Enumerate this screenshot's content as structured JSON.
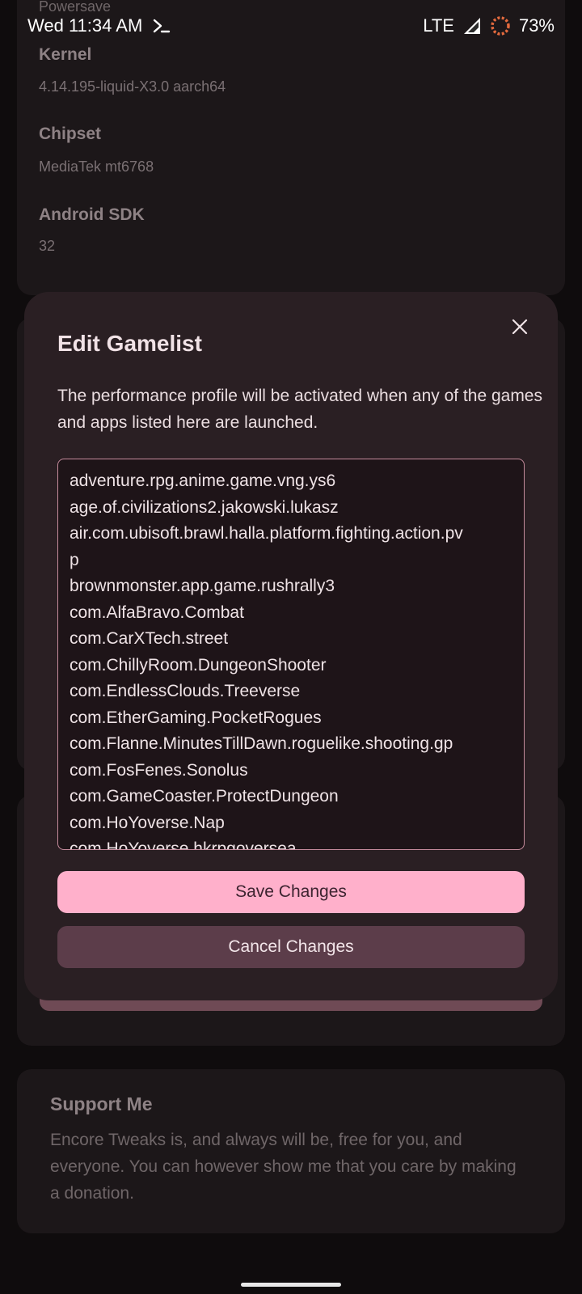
{
  "status_bar": {
    "time": "Wed 11:34 AM",
    "network": "LTE",
    "battery": "73%",
    "battery_ring_color": "#e36a3e"
  },
  "info_card": {
    "profile_value": "Powersave",
    "kernel_label": "Kernel",
    "kernel_value": "4.14.195-liquid-X3.0 aarch64",
    "chipset_label": "Chipset",
    "chipset_value": "MediaTek mt6768",
    "sdk_label": "Android SDK",
    "sdk_value": "32"
  },
  "dialog": {
    "title": "Edit Gamelist",
    "description": "The performance profile will be activated when any of the games and apps listed here are launched.",
    "gamelist": [
      "adventure.rpg.anime.game.vng.ys6",
      "age.of.civilizations2.jakowski.lukasz",
      "air.com.ubisoft.brawl.halla.platform.fighting.action.pv",
      "p",
      "brownmonster.app.game.rushrally3",
      "com.AlfaBravo.Combat",
      "com.CarXTech.street",
      "com.ChillyRoom.DungeonShooter",
      "com.EndlessClouds.Treeverse",
      "com.EtherGaming.PocketRogues",
      "com.Flanne.MinutesTillDawn.roguelike.shooting.gp",
      "com.FosFenes.Sonolus",
      "com.GameCoaster.ProtectDungeon",
      "com.HoYoverse.Nap",
      "com.HoYoverse.hkrpgoversea"
    ],
    "save_label": "Save Changes",
    "cancel_label": "Cancel Changes"
  },
  "support_card": {
    "title": "Support Me",
    "text": "Encore Tweaks is, and always will be, free for you, and everyone. You can however show me that you care by making a donation."
  }
}
